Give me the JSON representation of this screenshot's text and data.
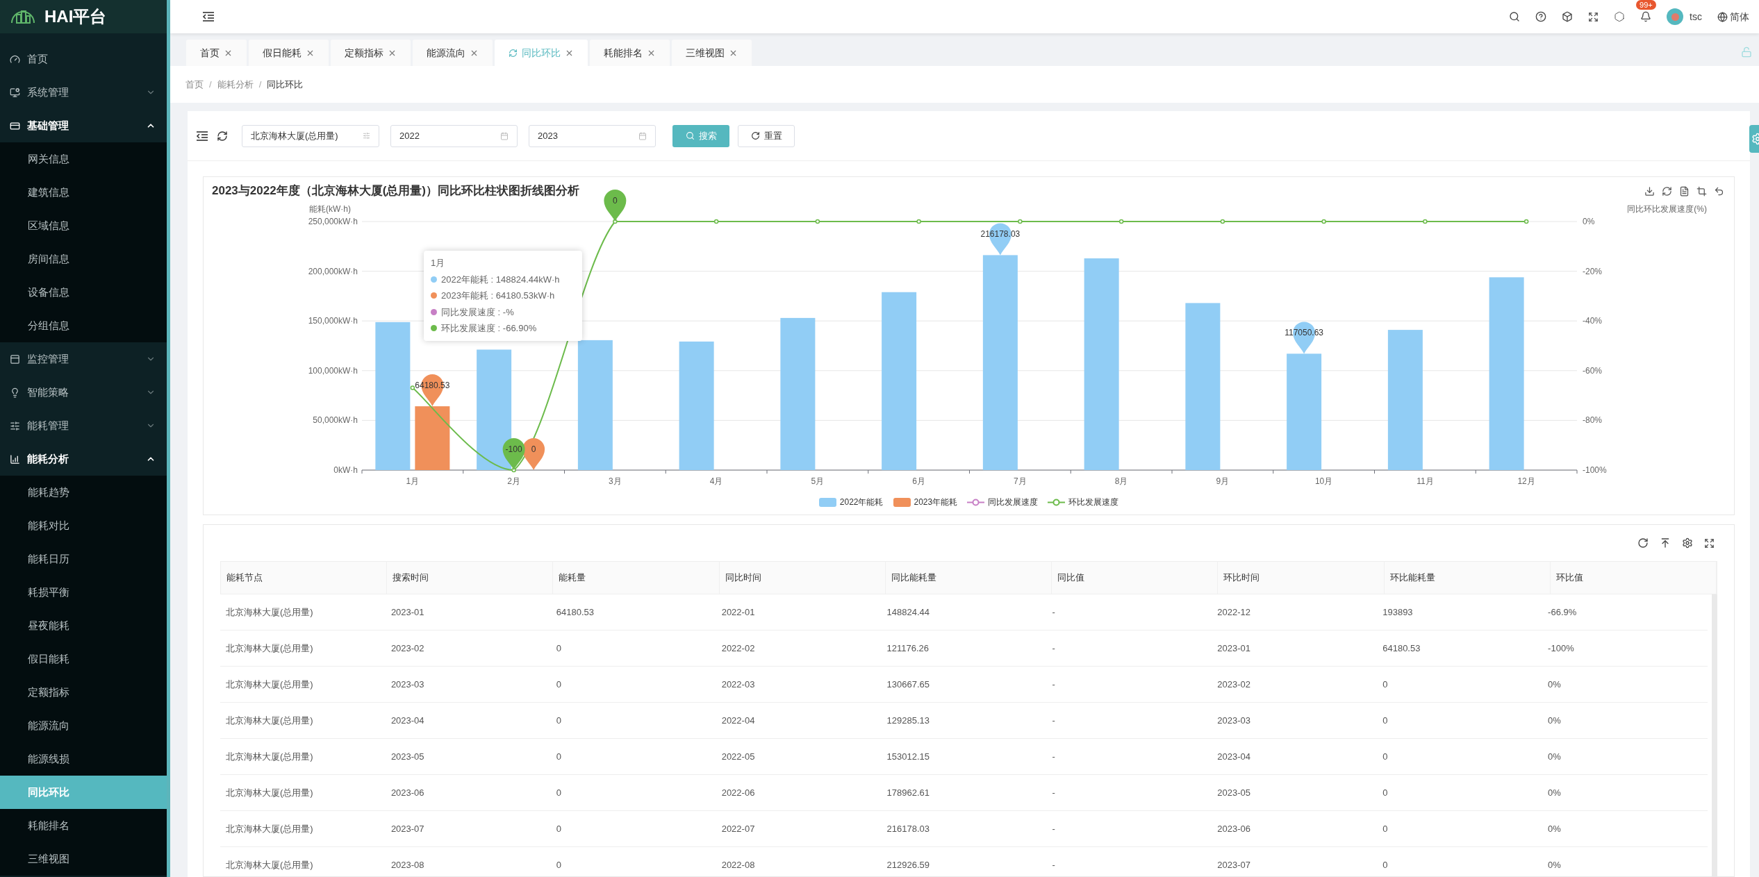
{
  "app": {
    "title": "HAI平台"
  },
  "sidebar": {
    "items": [
      {
        "label": "首页",
        "selected": false
      },
      {
        "label": "系统管理",
        "expanded": false
      },
      {
        "label": "基础管理",
        "expanded": true,
        "children": [
          {
            "label": "网关信息",
            "selected": false
          },
          {
            "label": "建筑信息",
            "selected": false
          },
          {
            "label": "区域信息",
            "selected": false
          },
          {
            "label": "房间信息",
            "selected": false
          },
          {
            "label": "设备信息",
            "selected": false
          },
          {
            "label": "分组信息",
            "selected": false
          }
        ]
      },
      {
        "label": "监控管理",
        "expanded": false
      },
      {
        "label": "智能策略",
        "expanded": false
      },
      {
        "label": "能耗管理",
        "expanded": false
      },
      {
        "label": "能耗分析",
        "expanded": true,
        "children": [
          {
            "label": "能耗趋势",
            "selected": false
          },
          {
            "label": "能耗对比",
            "selected": false
          },
          {
            "label": "能耗日历",
            "selected": false
          },
          {
            "label": "耗损平衡",
            "selected": false
          },
          {
            "label": "昼夜能耗",
            "selected": false
          },
          {
            "label": "假日能耗",
            "selected": false
          },
          {
            "label": "定额指标",
            "selected": false
          },
          {
            "label": "能源流向",
            "selected": false
          },
          {
            "label": "能源线损",
            "selected": false
          },
          {
            "label": "同比环比",
            "selected": true
          },
          {
            "label": "耗能排名",
            "selected": false
          },
          {
            "label": "三维视图",
            "selected": false
          }
        ]
      }
    ]
  },
  "header": {
    "notification_badge": "99+",
    "user": "tsc",
    "language": "简体"
  },
  "tabs": [
    {
      "label": "首页",
      "selected": false
    },
    {
      "label": "假日能耗",
      "selected": false
    },
    {
      "label": "定额指标",
      "selected": false
    },
    {
      "label": "能源流向",
      "selected": false
    },
    {
      "label": "同比环比",
      "selected": true
    },
    {
      "label": "耗能排名",
      "selected": false
    },
    {
      "label": "三维视图",
      "selected": false
    }
  ],
  "breadcrumb": {
    "separator": "/",
    "items": [
      "首页",
      "能耗分析",
      "同比环比"
    ]
  },
  "filters": {
    "node": "北京海林大厦(总用量)",
    "start_year": "2022",
    "end_year": "2023",
    "search_button": "搜索",
    "reset_button": "重置"
  },
  "chart": {
    "title": "2023与2022年度（北京海林大厦(总用量)）同比环比柱状图折线图分析",
    "tooltip": {
      "title": "1月",
      "items": [
        {
          "text": "2022年能耗 : 148824.44kW·h",
          "color": "#91cdf5"
        },
        {
          "text": "2023年能耗 : 64180.53kW·h",
          "color": "#f0905a"
        },
        {
          "text": "同比发展速度 : -%",
          "color": "#c77fc5"
        },
        {
          "text": "环比发展速度 : -66.90%",
          "color": "#6cbb4b"
        }
      ]
    },
    "chart_data": {
      "type": "bar",
      "ylabel": "能耗(kW·h)",
      "y2label": "同比环比发展速度(%)",
      "grid": true,
      "categories": [
        "1月",
        "2月",
        "3月",
        "4月",
        "5月",
        "6月",
        "7月",
        "8月",
        "9月",
        "10月",
        "11月",
        "12月"
      ],
      "ylim": [
        0,
        250000
      ],
      "y2lim": [
        -100,
        0
      ],
      "yticks": [
        {
          "value": 0,
          "label": "0kW·h"
        },
        {
          "value": 50000,
          "label": "50,000kW·h"
        },
        {
          "value": 100000,
          "label": "100,000kW·h"
        },
        {
          "value": 150000,
          "label": "150,000kW·h"
        },
        {
          "value": 200000,
          "label": "200,000kW·h"
        },
        {
          "value": 250000,
          "label": "250,000kW·h"
        }
      ],
      "y2ticks": [
        {
          "value": 0,
          "label": "0%"
        },
        {
          "value": -20,
          "label": "-20%"
        },
        {
          "value": -40,
          "label": "-40%"
        },
        {
          "value": -60,
          "label": "-60%"
        },
        {
          "value": -80,
          "label": "-80%"
        },
        {
          "value": -100,
          "label": "-100%"
        }
      ],
      "series": [
        {
          "name": "2022年能耗",
          "type": "bar",
          "color": "#91cdf5",
          "values": [
            148824.44,
            121176.26,
            130667.65,
            129285.13,
            153012.15,
            178962.61,
            216178.03,
            212926.59,
            168000,
            117050.63,
            141000,
            193893
          ]
        },
        {
          "name": "2023年能耗",
          "type": "bar",
          "color": "#f0905a",
          "values": [
            64180.53,
            0,
            0,
            0,
            0,
            0,
            0,
            0,
            0,
            0,
            0,
            0
          ]
        },
        {
          "name": "同比发展速度",
          "type": "line",
          "marker": true,
          "color": "#c77fc5",
          "values": [
            null,
            null,
            null,
            null,
            null,
            null,
            null,
            null,
            null,
            null,
            null,
            null
          ]
        },
        {
          "name": "环比发展速度",
          "type": "line",
          "axis": "y2",
          "marker": true,
          "color": "#6cbb4b",
          "values": [
            -66.9,
            -100,
            0,
            0,
            0,
            0,
            0,
            0,
            0,
            0,
            0,
            0
          ]
        }
      ]
    },
    "markers": [
      {
        "kind": "max",
        "color": "#91cdf5",
        "text": "216178.03"
      },
      {
        "kind": "min",
        "color": "#91cdf5",
        "text": "117050.63"
      },
      {
        "kind": "max",
        "color": "#f0905a",
        "text": "64180.53"
      },
      {
        "kind": "min",
        "color": "#f0905a",
        "text": "0"
      },
      {
        "kind": "max",
        "color": "#6cbb4b",
        "text": "0"
      },
      {
        "kind": "min",
        "color": "#6cbb4b",
        "text": "-100"
      }
    ]
  },
  "table": {
    "columns": [
      "能耗节点",
      "搜索时间",
      "能耗量",
      "同比时间",
      "同比能耗量",
      "同比值",
      "环比时间",
      "环比能耗量",
      "环比值"
    ],
    "rows": [
      [
        "北京海林大厦(总用量)",
        "2023-01",
        "64180.53",
        "2022-01",
        "148824.44",
        "-",
        "2022-12",
        "193893",
        "-66.9%"
      ],
      [
        "北京海林大厦(总用量)",
        "2023-02",
        "0",
        "2022-02",
        "121176.26",
        "-",
        "2023-01",
        "64180.53",
        "-100%"
      ],
      [
        "北京海林大厦(总用量)",
        "2023-03",
        "0",
        "2022-03",
        "130667.65",
        "-",
        "2023-02",
        "0",
        "0%"
      ],
      [
        "北京海林大厦(总用量)",
        "2023-04",
        "0",
        "2022-04",
        "129285.13",
        "-",
        "2023-03",
        "0",
        "0%"
      ],
      [
        "北京海林大厦(总用量)",
        "2023-05",
        "0",
        "2022-05",
        "153012.15",
        "-",
        "2023-04",
        "0",
        "0%"
      ],
      [
        "北京海林大厦(总用量)",
        "2023-06",
        "0",
        "2022-06",
        "178962.61",
        "-",
        "2023-05",
        "0",
        "0%"
      ],
      [
        "北京海林大厦(总用量)",
        "2023-07",
        "0",
        "2022-07",
        "216178.03",
        "-",
        "2023-06",
        "0",
        "0%"
      ],
      [
        "北京海林大厦(总用量)",
        "2023-08",
        "0",
        "2022-08",
        "212926.59",
        "-",
        "2023-07",
        "0",
        "0%"
      ]
    ]
  }
}
